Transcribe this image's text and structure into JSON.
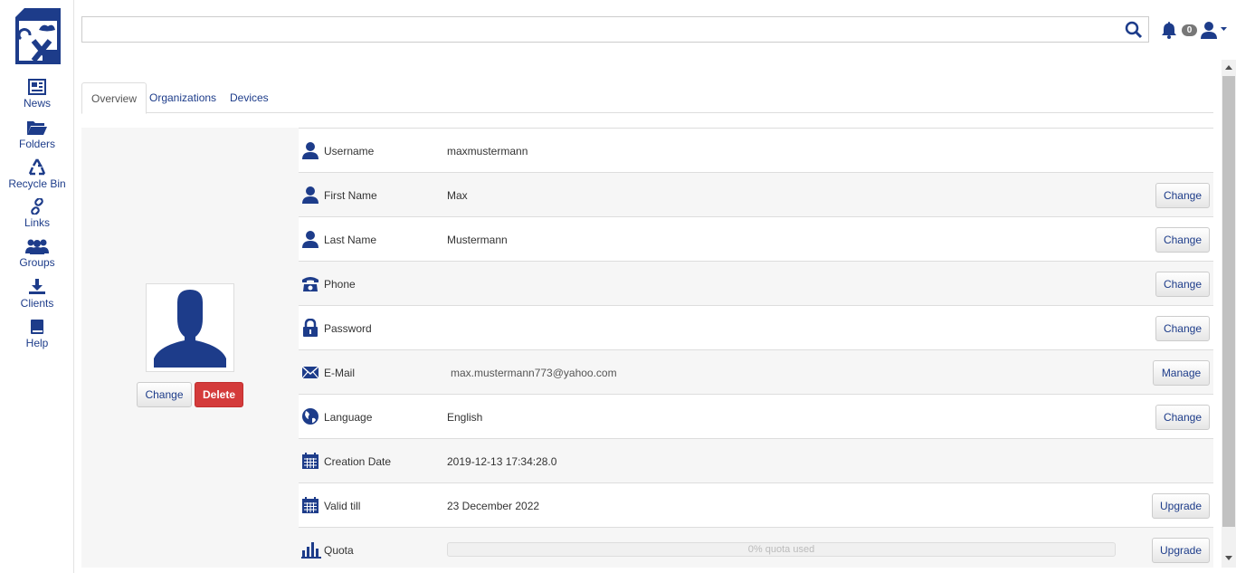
{
  "sidebar": {
    "items": [
      {
        "label": "News",
        "icon": "newspaper-icon"
      },
      {
        "label": "Folders",
        "icon": "folder-icon"
      },
      {
        "label": "Recycle Bin",
        "icon": "recycle-icon"
      },
      {
        "label": "Links",
        "icon": "link-icon"
      },
      {
        "label": "Groups",
        "icon": "users-icon"
      },
      {
        "label": "Clients",
        "icon": "download-icon"
      },
      {
        "label": "Help",
        "icon": "book-icon"
      }
    ]
  },
  "search": {
    "value": "",
    "placeholder": ""
  },
  "header": {
    "notification_count": "0"
  },
  "tabs": [
    {
      "label": "Overview",
      "active": true
    },
    {
      "label": "Organizations",
      "active": false
    },
    {
      "label": "Devices",
      "active": false
    }
  ],
  "avatar": {
    "change_label": "Change",
    "delete_label": "Delete"
  },
  "profile": {
    "rows": [
      {
        "label": "Username",
        "value": "maxmustermann",
        "icon": "user-icon",
        "button": ""
      },
      {
        "label": "First Name",
        "value": "Max",
        "icon": "user-icon",
        "button": "Change"
      },
      {
        "label": "Last Name",
        "value": "Mustermann",
        "icon": "user-icon",
        "button": "Change"
      },
      {
        "label": "Phone",
        "value": "",
        "icon": "phone-icon",
        "button": "Change"
      },
      {
        "label": "Password",
        "value": "",
        "icon": "lock-icon",
        "button": "Change"
      },
      {
        "label": "E-Mail",
        "value": "max.mustermann773@yahoo.com",
        "icon": "envelope-icon",
        "button": "Manage"
      },
      {
        "label": "Language",
        "value": "English",
        "icon": "globe-icon",
        "button": "Change"
      },
      {
        "label": "Creation Date",
        "value": "2019-12-13 17:34:28.0",
        "icon": "calendar-icon",
        "button": ""
      },
      {
        "label": "Valid till",
        "value": "23 December 2022",
        "icon": "calendar-icon",
        "button": "Upgrade"
      },
      {
        "label": "Quota",
        "value": "0% quota used",
        "icon": "bar-chart-icon",
        "button": "Upgrade",
        "quota_fraction": 0
      }
    ]
  },
  "colors": {
    "accent": "#1d3c8a",
    "danger": "#d43b3b"
  }
}
